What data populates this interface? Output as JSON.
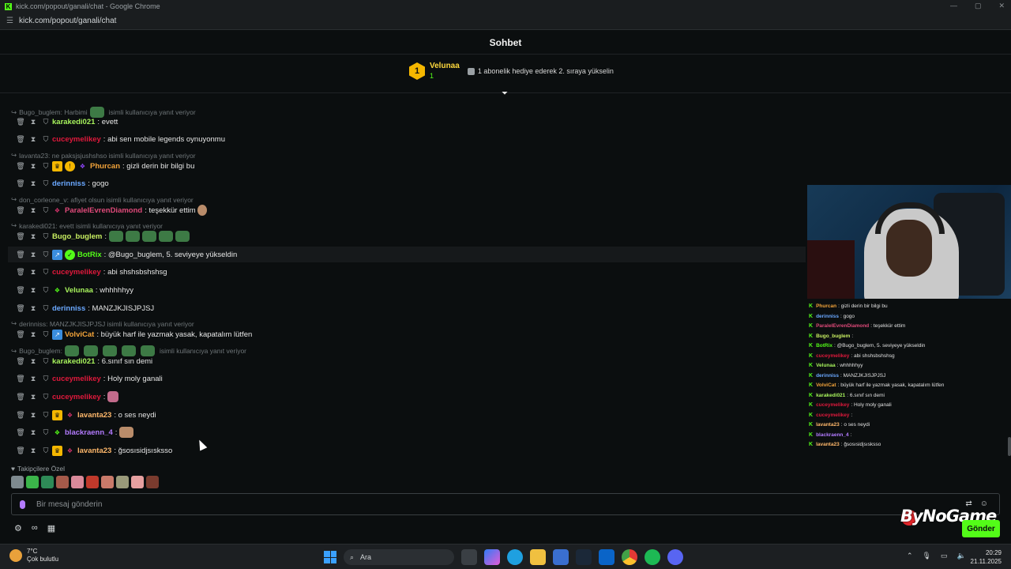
{
  "browser": {
    "title": "kick.com/popout/ganali/chat - Google Chrome",
    "url": "kick.com/popout/ganali/chat"
  },
  "chat": {
    "header": "Sohbet",
    "pinned": {
      "rank": "1",
      "user": "Velunaa",
      "count": "1",
      "gift_text": "1 abonelik hediye ederek 2. sıraya yükselin"
    },
    "replies": [
      {
        "text": "Bugo_buglem: Harbimi",
        "suffix": "isimli kullanıcıya yanıt veriyor"
      },
      {
        "text": "lavanta23: ne paksjsjushshso isimli kullanıcıya yanıt veriyor"
      },
      {
        "text": "don_corleone_v: afiyet olsun isimli kullanıcıya yanıt veriyor"
      },
      {
        "text": "karakedi021: evett isimli kullanıcıya yanıt veriyor"
      },
      {
        "text": "derinniss: MANZJKJISJPJSJ isimli kullanıcıya yanıt veriyor"
      },
      {
        "text": "Bugo_buglem:",
        "suffix": "isimli kullanıcıya yanıt veriyor"
      }
    ],
    "messages": [
      {
        "user": "karakedi021",
        "color": "#a7f25c",
        "text": "evett"
      },
      {
        "user": "cuceymelikey",
        "color": "#e0193c",
        "text": "abi sen mobile legends oynuyonmu"
      },
      {
        "user": "Phurcan",
        "color": "#f2a33a",
        "text": "gizli derin bir bilgi bu"
      },
      {
        "user": "derinniss",
        "color": "#6aa8ff",
        "text": "gogo"
      },
      {
        "user": "ParalelEvrenDiamond",
        "color": "#e04a7a",
        "text": "teşekkür ettim"
      },
      {
        "user": "Bugo_buglem",
        "color": "#c9f062",
        "text": ""
      },
      {
        "user": "BotRix",
        "color": "#53fc18",
        "text": "@Bugo_buglem, 5. seviyeye yükseldin"
      },
      {
        "user": "cuceymelikey",
        "color": "#e0193c",
        "text": "abi shshsbshshsg"
      },
      {
        "user": "Velunaa",
        "color": "#a7f25c",
        "text": "whhhhhyy"
      },
      {
        "user": "derinniss",
        "color": "#6aa8ff",
        "text": "MANZJKJISJPJSJ"
      },
      {
        "user": "VolviCat",
        "color": "#f2a33a",
        "text": "büyük harf ile yazmak yasak, kapatalım lütfen"
      },
      {
        "user": "karakedi021",
        "color": "#a7f25c",
        "text": "6.sınıf sın demi"
      },
      {
        "user": "cuceymelikey",
        "color": "#e0193c",
        "text": "Holy moly ganali"
      },
      {
        "user": "cuceymelikey",
        "color": "#e0193c",
        "text": ""
      },
      {
        "user": "lavanta23",
        "color": "#ffb86b",
        "text": "o ses neydi"
      },
      {
        "user": "blackraenn_4",
        "color": "#b37bff",
        "text": ""
      },
      {
        "user": "lavanta23",
        "color": "#ffb86b",
        "text": "ğsosısidjsısksso"
      }
    ],
    "followers_label": "Takipçilere Özel",
    "input_placeholder": "Bir mesaj gönderin",
    "send_label": "Gönder"
  },
  "overlay": {
    "logo": "ByNoGame",
    "messages": [
      {
        "user": "Phurcan",
        "color": "#f2a33a",
        "text": ": gizli derin bir bilgi bu"
      },
      {
        "user": "derinniss",
        "color": "#6aa8ff",
        "text": ": gogo"
      },
      {
        "user": "ParalelEvrenDiamond",
        "color": "#e04a7a",
        "text": ": teşekkür ettim"
      },
      {
        "user": "Bugo_buglem",
        "color": "#c9f062",
        "text": ":"
      },
      {
        "user": "BotRix",
        "color": "#53fc18",
        "text": ": @Bugo_buglem, 5. seviyeye yükseldin"
      },
      {
        "user": "cuceymelikey",
        "color": "#e0193c",
        "text": ": abi shshsbshshsg"
      },
      {
        "user": "Velunaa",
        "color": "#a7f25c",
        "text": ": whhhhhyy"
      },
      {
        "user": "derinniss",
        "color": "#6aa8ff",
        "text": ": MANZJKJISJPJSJ"
      },
      {
        "user": "VolviCat",
        "color": "#f2a33a",
        "text": ": büyük harf ile yazmak yasak, kapatalım lütfen"
      },
      {
        "user": "karakedi021",
        "color": "#a7f25c",
        "text": ": 6.sınıf sın demi"
      },
      {
        "user": "cuceymelikey",
        "color": "#e0193c",
        "text": ": Holy moly ganali"
      },
      {
        "user": "cuceymelikey",
        "color": "#e0193c",
        "text": ":"
      },
      {
        "user": "lavanta23",
        "color": "#ffb86b",
        "text": ": o ses neydi"
      },
      {
        "user": "blackraenn_4",
        "color": "#b37bff",
        "text": ":"
      },
      {
        "user": "lavanta23",
        "color": "#ffb86b",
        "text": ": ğsosısidjsısksso"
      }
    ]
  },
  "taskbar": {
    "temp": "7°C",
    "weather": "Çok bulutlu",
    "search": "Ara",
    "time": "20:29",
    "date": "21.11.2025"
  }
}
